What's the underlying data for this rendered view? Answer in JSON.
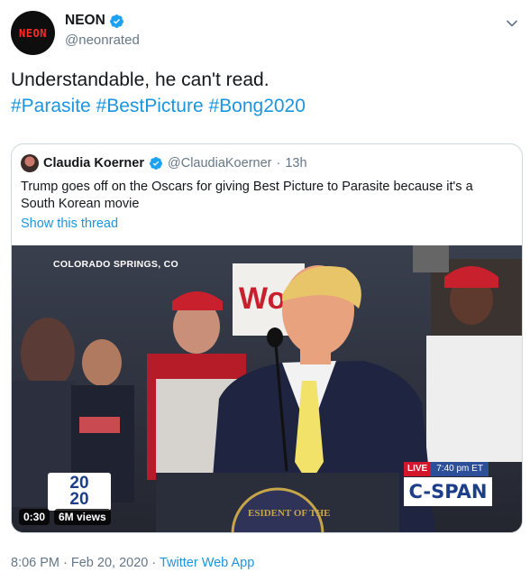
{
  "author": {
    "avatar_text": "NEON",
    "display_name": "NEON",
    "handle": "@neonrated"
  },
  "tweet": {
    "text_line": "Understandable, he can't read.",
    "hashtags": [
      "#Parasite",
      "#BestPicture",
      "#Bong2020"
    ]
  },
  "quoted": {
    "display_name": "Claudia Koerner",
    "handle": "@ClaudiaKoerner",
    "separator": "·",
    "time": "13h",
    "text": "Trump goes off on the Oscars for giving Best Picture to Parasite because it's a South Korean movie",
    "show_thread": "Show this thread",
    "video": {
      "location": "COLORADO SPRINGS, CO",
      "live_label": "LIVE",
      "live_time": "7:40 pm ET",
      "network": "C-SPAN",
      "logo_top": "20",
      "logo_bottom": "20",
      "duration": "0:30",
      "views": "6M views"
    }
  },
  "footer": {
    "timestamp": "8:06 PM · Feb 20, 2020 · ",
    "app": "Twitter Web App"
  },
  "colors": {
    "link": "#1b95e0",
    "secondary_text": "#657786",
    "border": "#ccd6dd",
    "avatar_bg": "#0e0e0e",
    "avatar_text": "#ff2a2a",
    "live_red": "#d4162c",
    "cspan_blue": "#1d3f8a"
  }
}
